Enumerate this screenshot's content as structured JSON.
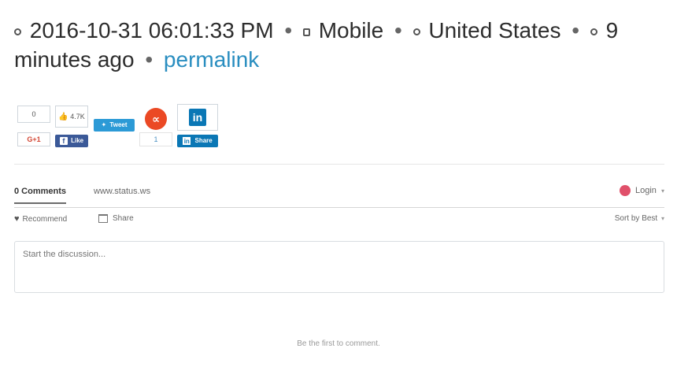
{
  "meta": {
    "datetime": "2016-10-31 06:01:33 PM",
    "device": "Mobile",
    "location": "United States",
    "ago": "9 minutes ago",
    "permalink": "permalink"
  },
  "share": {
    "like_count": "0",
    "fb_count": "4.7K",
    "gplus_label": "G+1",
    "fb_like_label": "Like",
    "tweet_label": "Tweet",
    "stumble_count": "1",
    "linkedin_label": "Share"
  },
  "comments": {
    "tab_comments": "0 Comments",
    "tab_site": "www.status.ws",
    "login": "Login",
    "recommend": "Recommend",
    "share": "Share",
    "sort": "Sort by Best",
    "placeholder": "Start the discussion...",
    "empty": "Be the first to comment."
  },
  "colors": {
    "permalink": "#2a8ec0",
    "facebook": "#3b5998",
    "twitter": "#2c9ad6",
    "stumble": "#eb4924",
    "linkedin": "#0a77b5",
    "login_icon": "#e0506a"
  },
  "icons": [
    "clock-icon",
    "mobile-icon",
    "globe-icon",
    "eye-icon",
    "like-icon",
    "heart-icon",
    "share-icon"
  ]
}
